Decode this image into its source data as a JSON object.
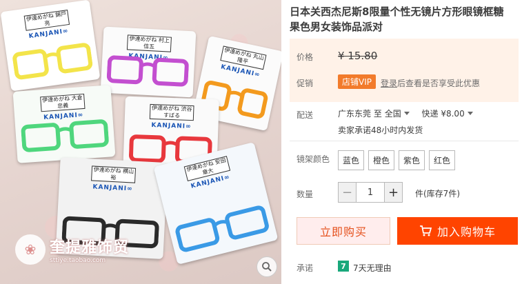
{
  "product": {
    "title": "日本关西杰尼斯8限量个性无镜片方形眼镜框糖果色男女装饰品派对"
  },
  "photo": {
    "cards": [
      {
        "tag": "伊達めがね\n錦戸 亮",
        "brand": "KANJANI∞",
        "color": "#f3e44a"
      },
      {
        "tag": "伊達めがね\n村上 信五",
        "brand": "KANJANI∞",
        "color": "#c34fd0"
      },
      {
        "tag": "伊達めがね\n丸山 隆平",
        "brand": "KANJANI∞",
        "color": "#f39a1e"
      },
      {
        "tag": "伊達めがね\n大倉 忠義",
        "brand": "KANJANI∞",
        "color": "#4fd67d"
      },
      {
        "tag": "伊達めがね\n渋谷 すばる",
        "brand": "KANJANI∞",
        "color": "#e8383d"
      },
      {
        "tag": "伊達めがね\n横山 裕",
        "brand": "KANJANI∞",
        "color": "#2a2a2a"
      },
      {
        "tag": "伊達めがね\n安田 章大",
        "brand": "KANJANI∞",
        "color": "#3a9ae6"
      }
    ],
    "watermark_name": "奎提雅饰贸",
    "watermark_url": "sttiye.taobao.com"
  },
  "price": {
    "label": "价格",
    "value": "¥ 15.80"
  },
  "promotion": {
    "label": "促销",
    "badge": "店铺VIP",
    "login_link": "登录",
    "note": "后查看是否享受此优惠"
  },
  "shipping": {
    "label": "配送",
    "from": "广东东莞",
    "to_word": "至",
    "to": "全国",
    "method": "快递 ¥8.00",
    "promise": "卖家承诺48小时内发货"
  },
  "frame_color": {
    "label": "镜架颜色",
    "options": [
      "蓝色",
      "橙色",
      "紫色",
      "红色"
    ]
  },
  "quantity": {
    "label": "数量",
    "value": "1",
    "minus": "−",
    "plus": "+",
    "stock": "件(库存7件)"
  },
  "actions": {
    "buy_now": "立即购买",
    "add_to_cart": "加入购物车"
  },
  "guarantee": {
    "label": "承诺",
    "badge": "7",
    "text": "7天无理由"
  },
  "colors": {
    "accent": "#ff4400",
    "buy_text": "#e5511d",
    "price_bg": "#fff2e8",
    "vip_badge": "#f27b2b",
    "guarantee_badge": "#19a87b"
  },
  "icons": {
    "zoom": "magnifier-icon",
    "cart": "cart-icon",
    "caret": "caret-down-icon"
  }
}
